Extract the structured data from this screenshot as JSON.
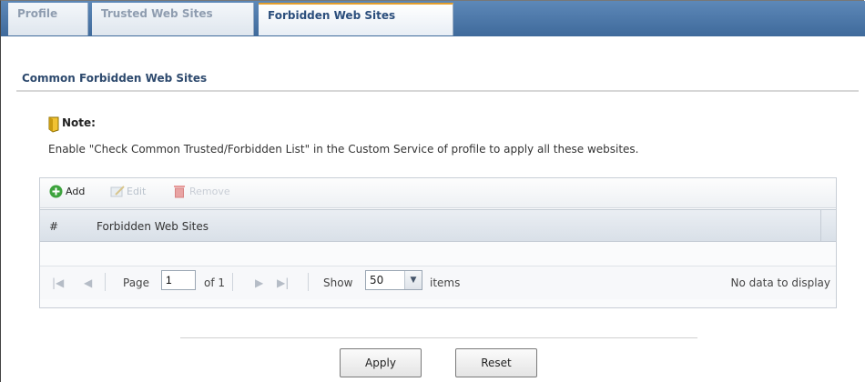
{
  "tabs": [
    {
      "label": "Profile",
      "active": false
    },
    {
      "label": "Trusted Web Sites",
      "active": false
    },
    {
      "label": "Forbidden Web Sites",
      "active": true
    }
  ],
  "section": {
    "title": "Common Forbidden Web Sites"
  },
  "note": {
    "title": "Note:",
    "text": "Enable \"Check Common Trusted/Forbidden List\" in the Custom Service of profile to apply all these websites.",
    "icon": "note-icon"
  },
  "toolbar": {
    "add_label": "Add",
    "edit_label": "Edit",
    "remove_label": "Remove"
  },
  "table": {
    "columns": [
      "#",
      "Forbidden Web Sites"
    ],
    "rows": []
  },
  "pager": {
    "page_label": "Page",
    "page_value": "1",
    "of_label": "of 1",
    "show_label": "Show",
    "show_value": "50",
    "items_label": "items",
    "status_text": "No data to display"
  },
  "buttons": {
    "apply_label": "Apply",
    "reset_label": "Reset"
  },
  "colors": {
    "tab_bar": "#4a76a8",
    "active_tab_accent": "#e49e2c",
    "title_text": "#2e4a6e"
  }
}
